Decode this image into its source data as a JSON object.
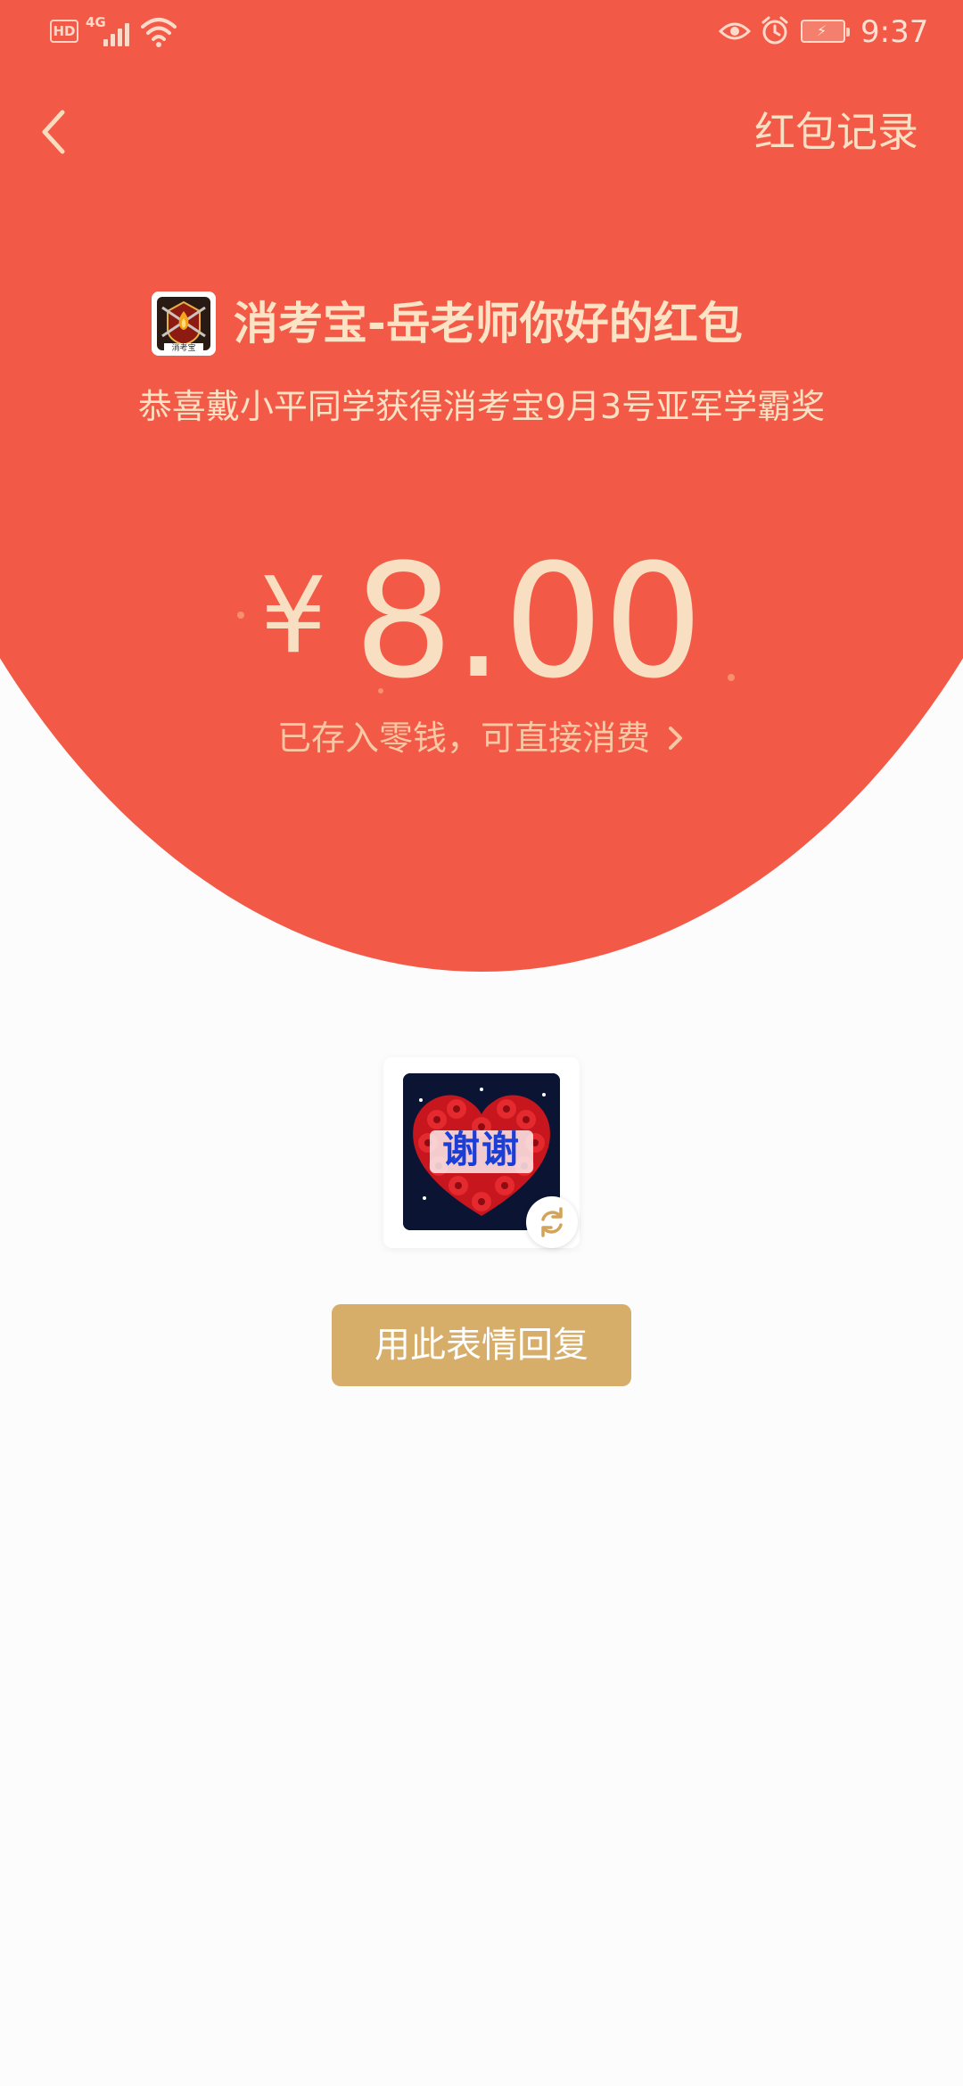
{
  "status_bar": {
    "hd_label": "HD",
    "network_label": "4G",
    "time": "9:37",
    "icons": [
      "signal-icon",
      "wifi-icon",
      "eye-comfort-icon",
      "alarm-icon",
      "battery-charging-icon"
    ]
  },
  "nav": {
    "back_icon": "chevron-left-icon",
    "records_label": "红包记录"
  },
  "sender": {
    "logo_icon": "fire-department-badge-icon",
    "logo_caption": "消考宝",
    "title": "消考宝-岳老师你好的红包"
  },
  "greeting": "恭喜戴小平同学获得消考宝9月3号亚军学霸奖",
  "amount": {
    "currency": "¥",
    "value": "8.00",
    "note": "已存入零钱，可直接消费",
    "note_icon": "chevron-right-icon"
  },
  "sticker": {
    "caption": "谢谢",
    "image": "red-roses-heart-image",
    "refresh_icon": "refresh-icon"
  },
  "reply_button_label": "用此表情回复",
  "colors": {
    "header_red": "#F25A47",
    "gold_text": "#F9DFC2",
    "button_gold": "#D7AD6A",
    "background": "#FDFCFD"
  }
}
